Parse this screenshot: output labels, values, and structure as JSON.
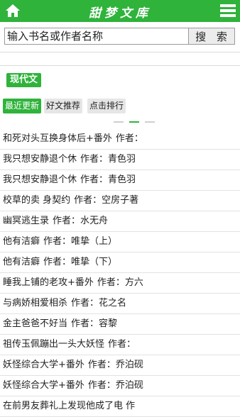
{
  "header": {
    "title": "甜梦文库",
    "home_icon": "home-icon",
    "menu_icon": "menu-icon",
    "accent_color": "#2fb33b"
  },
  "search": {
    "placeholder": "输入书名或作者名称",
    "button_label": "搜 索"
  },
  "category": {
    "label": "现代文"
  },
  "tabs": [
    {
      "label": "最近更新",
      "active": true
    },
    {
      "label": "好文推荐",
      "active": false
    },
    {
      "label": "点击排行",
      "active": false
    }
  ],
  "pager": {
    "count": 3,
    "active_index": 1
  },
  "books": [
    {
      "title": "和死对头互换身体后+番外",
      "author_label": "作者：",
      "author": ""
    },
    {
      "title": "我只想安静退个休",
      "author_label": "作者：",
      "author": "青色羽"
    },
    {
      "title": "我只想安静退个休",
      "author_label": "作者：",
      "author": "青色羽"
    },
    {
      "title": "校草的卖 身契约",
      "author_label": "作者：",
      "author": "空房子著"
    },
    {
      "title": "幽冥逃生录",
      "author_label": "作者：",
      "author": "水无舟"
    },
    {
      "title": "他有洁癖",
      "author_label": "作者：",
      "author": "唯挚（上）"
    },
    {
      "title": "他有洁癖",
      "author_label": "作者：",
      "author": "唯挚（下）"
    },
    {
      "title": "睡我上铺的老攻+番外",
      "author_label": "作者：",
      "author": "方六"
    },
    {
      "title": "与病娇相爱相杀",
      "author_label": "作者：",
      "author": "花之名"
    },
    {
      "title": "金主爸爸不好当",
      "author_label": "作者：",
      "author": "容黎"
    },
    {
      "title": "祖传玉佩蹦出一头大妖怪",
      "author_label": "作者：",
      "author": ""
    },
    {
      "title": "妖怪综合大学+番外",
      "author_label": "作者：",
      "author": "乔泊砚"
    },
    {
      "title": "妖怪综合大学+番外",
      "author_label": "作者：",
      "author": "乔泊砚"
    },
    {
      "title": "在前男友葬礼上发现他成了电 作",
      "author_label": "",
      "author": ""
    }
  ]
}
